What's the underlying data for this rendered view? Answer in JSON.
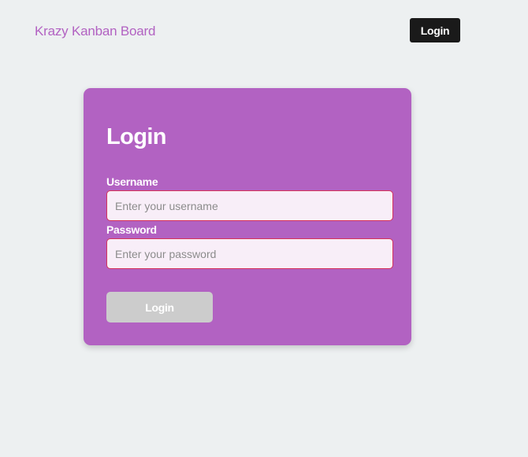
{
  "header": {
    "brand": "Krazy Kanban Board",
    "login_button": "Login"
  },
  "login_form": {
    "title": "Login",
    "username": {
      "label": "Username",
      "placeholder": "Enter your username",
      "value": ""
    },
    "password": {
      "label": "Password",
      "placeholder": "Enter your password",
      "value": ""
    },
    "submit_label": "Login"
  },
  "colors": {
    "page_background": "#edf0f1",
    "accent": "#b262c2",
    "nav_button": "#1a1a1a",
    "input_border": "#d6335a",
    "input_background": "#f8eef8",
    "submit_disabled": "#cccccc"
  }
}
